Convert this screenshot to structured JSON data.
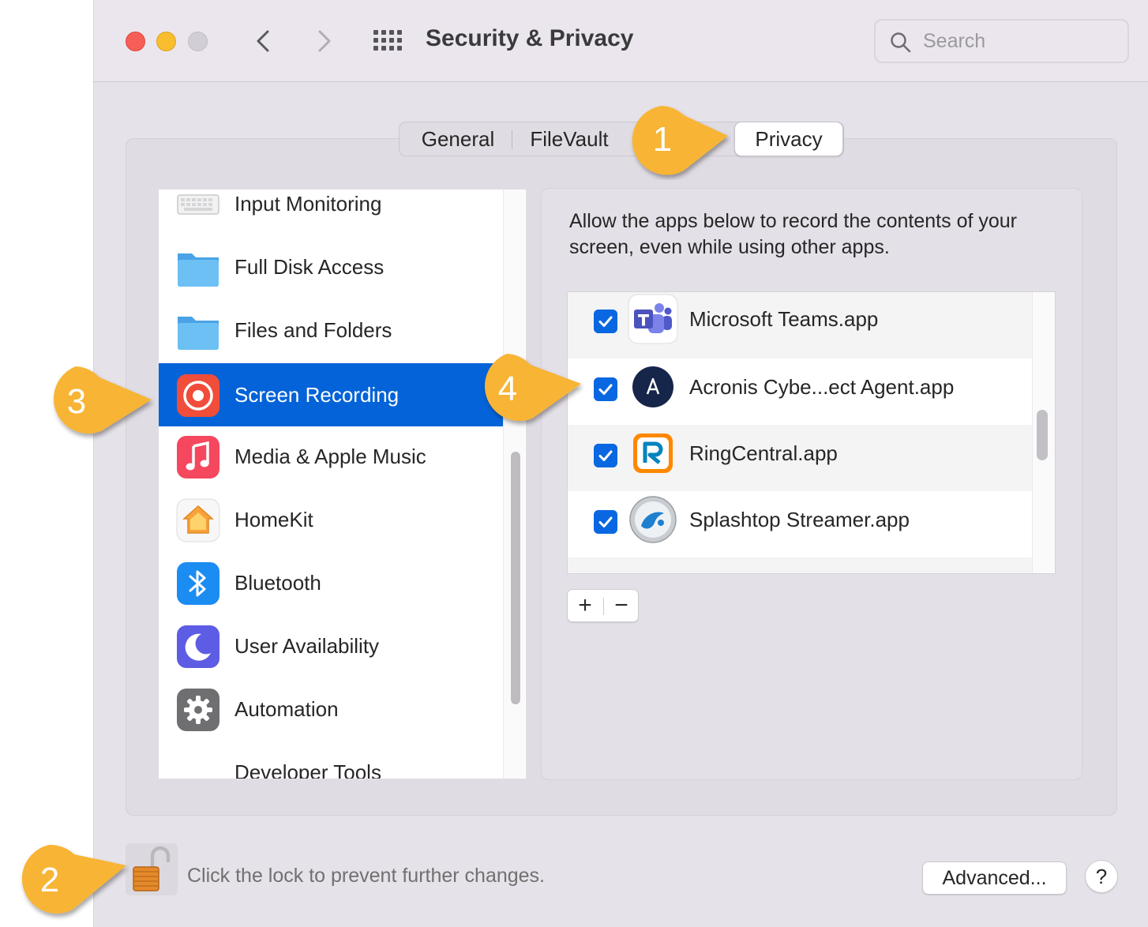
{
  "window": {
    "title": "Security & Privacy"
  },
  "search": {
    "placeholder": "Search"
  },
  "tabs": [
    {
      "label": "General"
    },
    {
      "label": "FileVault"
    },
    {
      "label": "Privacy",
      "selected": true
    }
  ],
  "sidebar": {
    "items": [
      {
        "label": "Input Monitoring",
        "icon": "keyboard-icon"
      },
      {
        "label": "Full Disk Access",
        "icon": "folder-icon"
      },
      {
        "label": "Files and Folders",
        "icon": "folder-icon"
      },
      {
        "label": "Screen Recording",
        "icon": "screen-recording-icon",
        "selected": true
      },
      {
        "label": "Media & Apple Music",
        "icon": "music-icon"
      },
      {
        "label": "HomeKit",
        "icon": "home-icon"
      },
      {
        "label": "Bluetooth",
        "icon": "bluetooth-icon"
      },
      {
        "label": "User Availability",
        "icon": "moon-icon"
      },
      {
        "label": "Automation",
        "icon": "gear-icon"
      },
      {
        "label": "Developer Tools",
        "icon": "hammer-icon"
      }
    ]
  },
  "main": {
    "description": "Allow the apps below to record the contents of your screen, even while using other apps.",
    "apps": [
      {
        "name": "Microsoft Teams.app",
        "checked": true,
        "icon": "teams-icon"
      },
      {
        "name": "Acronis Cybe...ect Agent.app",
        "checked": true,
        "icon": "acronis-icon"
      },
      {
        "name": "RingCentral.app",
        "checked": true,
        "icon": "ringcentral-icon"
      },
      {
        "name": "Splashtop Streamer.app",
        "checked": true,
        "icon": "splashtop-icon"
      }
    ],
    "add_label": "+",
    "remove_label": "−"
  },
  "footer": {
    "lock_text": "Click the lock to prevent further changes.",
    "advanced_label": "Advanced...",
    "help_label": "?"
  },
  "callouts": [
    "1",
    "2",
    "3",
    "4"
  ],
  "colors": {
    "accent": "#0463d8",
    "checkbox": "#0a67e2",
    "callout": "#f8b434"
  }
}
